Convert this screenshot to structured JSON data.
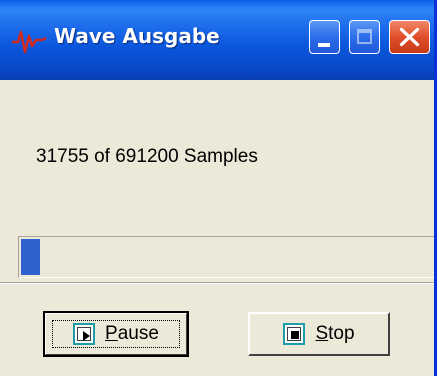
{
  "window": {
    "title": "Wave Ausgabe",
    "icon": "waveform-icon",
    "controls": {
      "minimize": "minimize-icon",
      "maximize": "maximize-icon",
      "close": "close-icon"
    }
  },
  "status": {
    "text": "31755 of 691200 Samples"
  },
  "progress": {
    "value": 31755,
    "max": 691200,
    "fraction": 0.046,
    "color": "#3161CD"
  },
  "buttons": {
    "pause": {
      "mnemonic": "P",
      "rest": "ause",
      "icon": "play-icon"
    },
    "stop": {
      "mnemonic": "S",
      "rest": "top",
      "icon": "stop-icon"
    }
  },
  "colors": {
    "titlebar": "#0A55DB",
    "face": "#ECE9D8",
    "close": "#E04E2A",
    "icon_border": "#1E9DA8"
  }
}
